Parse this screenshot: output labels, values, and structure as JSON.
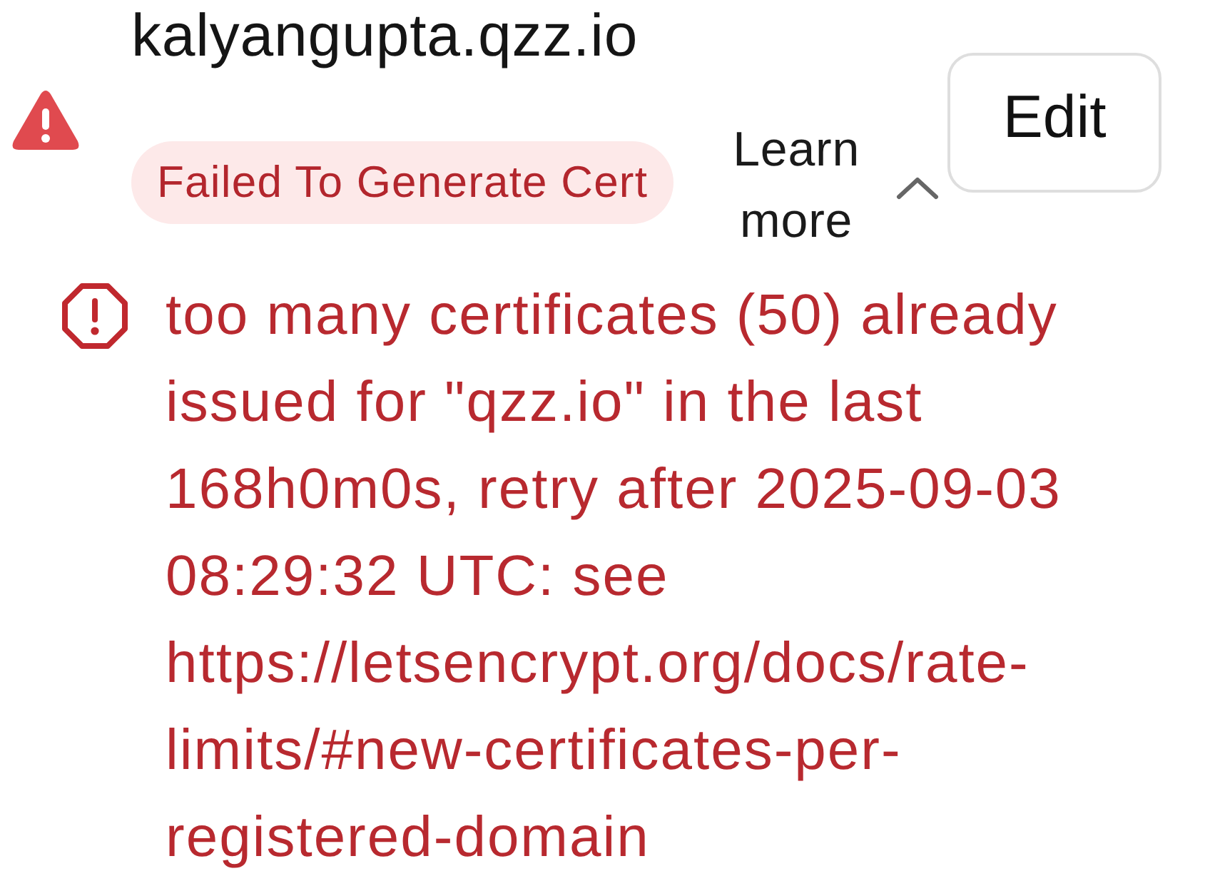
{
  "domain": {
    "title": "kalyangupta.qzz.io"
  },
  "status": {
    "badge": "Failed To Generate Cert"
  },
  "learn_more": {
    "label": "Learn more",
    "expanded": true
  },
  "edit_button": {
    "label": "Edit"
  },
  "error_message": {
    "text": "too many certificates (50) already issued for \"qzz.io\" in the last 168h0m0s, retry after 2025-09-03 08:29:32 UTC: see https://letsencrypt.org/docs/rate-limits/#new-certificates-per-registered-domain"
  }
}
